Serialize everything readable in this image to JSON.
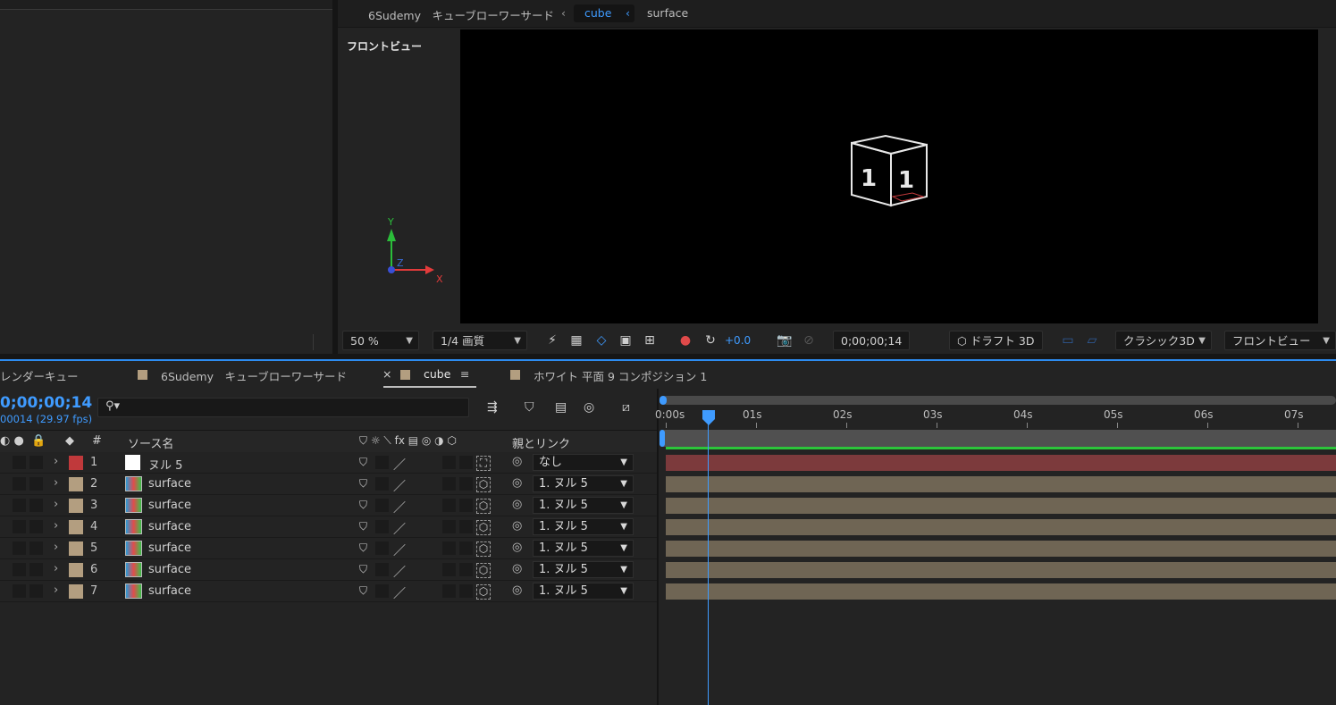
{
  "viewer": {
    "breadcrumbs": [
      "6Sudemy　キューブローワーサード",
      "cube",
      "surface"
    ],
    "view_label": "フロントビュー",
    "axis": {
      "y": "Y",
      "z": "Z",
      "x": "X"
    },
    "toolbar": {
      "zoom": "50 %",
      "resolution": "1/4 画質",
      "exposure": "+0.0",
      "timecode": "0;00;00;14",
      "draft3d": "ドラフト 3D",
      "renderer": "クラシック3D",
      "view": "フロントビュー"
    }
  },
  "timeline": {
    "tabs": [
      {
        "label": "レンダーキュー"
      },
      {
        "label": "6Sudemy　キューブローワーサード",
        "color": "#b39e80"
      },
      {
        "label": "cube",
        "color": "#b39e80"
      },
      {
        "label": "ホワイト 平面 9 コンポジション 1",
        "color": "#b39e80"
      }
    ],
    "timecode": "0;00;00;14",
    "fps": "00014 (29.97 fps)",
    "columns": {
      "num": "#",
      "source": "ソース名",
      "parent": "親とリンク"
    },
    "ruler": [
      "0:00s",
      "01s",
      "02s",
      "03s",
      "04s",
      "05s",
      "06s",
      "07s"
    ],
    "layers": [
      {
        "num": "1",
        "name": "ヌル 5",
        "label_color": "#c0393b",
        "parent": "なし",
        "type": "null"
      },
      {
        "num": "2",
        "name": "surface",
        "label_color": "#b39e80",
        "parent": "1. ヌル 5",
        "type": "comp"
      },
      {
        "num": "3",
        "name": "surface",
        "label_color": "#b39e80",
        "parent": "1. ヌル 5",
        "type": "comp"
      },
      {
        "num": "4",
        "name": "surface",
        "label_color": "#b39e80",
        "parent": "1. ヌル 5",
        "type": "comp"
      },
      {
        "num": "5",
        "name": "surface",
        "label_color": "#b39e80",
        "parent": "1. ヌル 5",
        "type": "comp"
      },
      {
        "num": "6",
        "name": "surface",
        "label_color": "#b39e80",
        "parent": "1. ヌル 5",
        "type": "comp"
      },
      {
        "num": "7",
        "name": "surface",
        "label_color": "#b39e80",
        "parent": "1. ヌル 5",
        "type": "comp"
      }
    ],
    "track_colors": {
      "null": "#7c3a3c",
      "comp": "#6f6554"
    }
  }
}
